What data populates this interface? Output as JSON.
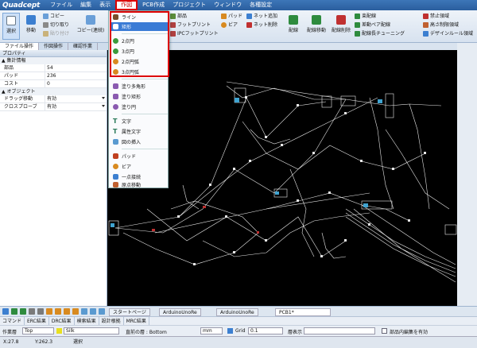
{
  "menubar": {
    "logo": "Quadcept",
    "items": [
      "ファイル",
      "編集",
      "表示",
      "作図",
      "PCB作成",
      "プロジェクト",
      "ウィンドウ",
      "各種設定"
    ],
    "active_index": 3
  },
  "ribbon": {
    "select_label": "選択",
    "move_label": "移動",
    "copy_label": "コピー",
    "cut_label": "切り取り",
    "paste_label": "貼り付け",
    "copy_cont_label": "コピー(連続)",
    "part_label": "部品",
    "footprint_label": "フットプリント",
    "ipc_footprint_label": "IPCフットプリント",
    "pad_label": "パッド",
    "via_label": "ビア",
    "net_add_label": "ネット追加",
    "net_delete_label": "ネット削除",
    "route_label": "配線",
    "route_move_label": "配線移動",
    "route_delete_label": "配線削除",
    "bulk_route_label": "束配線",
    "diff_pair_label": "差動ペア配線",
    "length_tuning_label": "配線長チューニング",
    "keepout_label": "禁止領域",
    "height_limit_label": "高さ制限領域",
    "design_rule_label": "デザインルール領域"
  },
  "panel_tabs": [
    "ファイル操作",
    "作図操作",
    "確認作業"
  ],
  "properties": {
    "title": "プロパティ",
    "section_summary": "集計情報",
    "rows": [
      {
        "key": "部品",
        "value": "54"
      },
      {
        "key": "パッド",
        "value": "236"
      },
      {
        "key": "コスト",
        "value": "0"
      }
    ],
    "section_object": "オブジェクト",
    "object_rows": [
      {
        "key": "ドラッグ移動",
        "value": "有効"
      },
      {
        "key": "クロスプローブ",
        "value": "有効"
      }
    ]
  },
  "draw_menu": {
    "items": [
      {
        "label": "ライン"
      },
      {
        "label": "矩形"
      },
      {
        "label": "2点円"
      },
      {
        "label": "3点円"
      },
      {
        "label": "2点円弧"
      },
      {
        "label": "3点円弧"
      },
      {
        "label": "塗り多角形"
      },
      {
        "label": "塗り矩形"
      },
      {
        "label": "塗り円"
      },
      {
        "label": "文字"
      },
      {
        "label": "属性文字"
      },
      {
        "label": "図の挿入"
      },
      {
        "label": "パッド"
      },
      {
        "label": "ビア"
      },
      {
        "label": "一点接続"
      },
      {
        "label": "原点移動"
      }
    ],
    "highlighted": "矩形"
  },
  "doc_tabs": [
    "スタートページ",
    "ArduinoUnoRe",
    "ArduinoUnoRe",
    "PCB1*"
  ],
  "bottom_tabs": [
    "コマンド",
    "ERC結果",
    "DRC結果",
    "検索結果",
    "設計根拠",
    "MRC結果"
  ],
  "bottom_bar": {
    "layer_label": "作業層",
    "layer_value": "Top",
    "silk_value": "Silk",
    "view_label": "直前の層 : Bottom",
    "unit_value": "mm",
    "grid_label": "Grid",
    "grid_value": "0.1",
    "display_label": "層表示",
    "part_edit_label": "部品内編集を有効"
  },
  "status": {
    "x": "X:27.8",
    "y": "Y:262.3",
    "mode": "選択"
  },
  "colors": {
    "menubar": "#2f66a8",
    "canvas": "#000000",
    "highlight": "#d00000",
    "menu_highlight": "#3a7bd5"
  }
}
